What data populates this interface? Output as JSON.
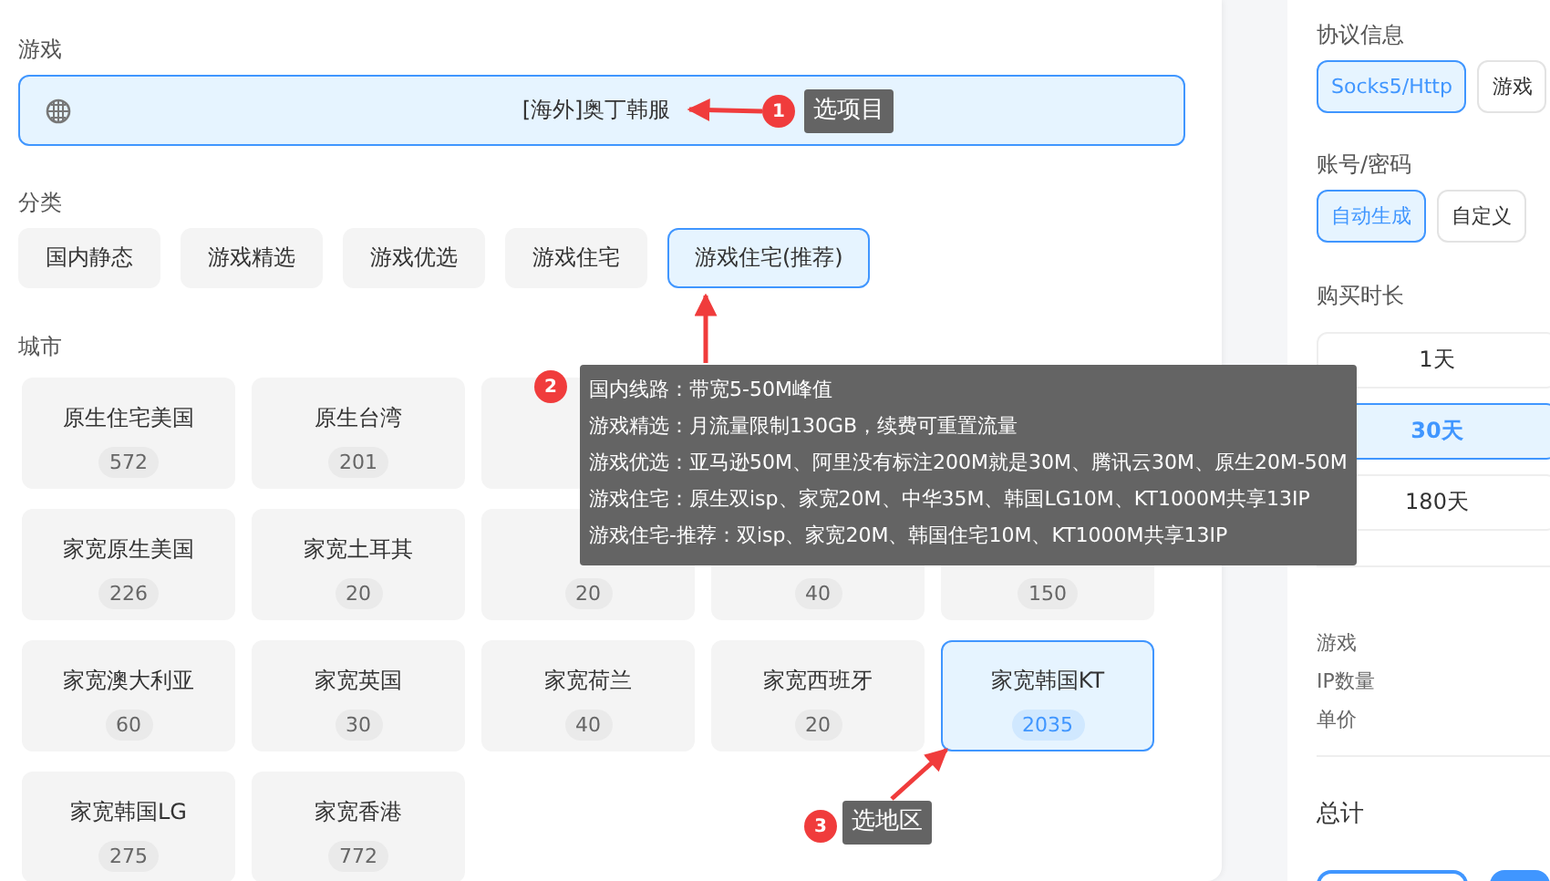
{
  "game": {
    "label": "游戏",
    "value": "[海外]奥丁韩服"
  },
  "category": {
    "label": "分类",
    "options": [
      {
        "label": "国内静态",
        "selected": false
      },
      {
        "label": "游戏精选",
        "selected": false
      },
      {
        "label": "游戏优选",
        "selected": false
      },
      {
        "label": "游戏住宅",
        "selected": false
      },
      {
        "label": "游戏住宅(推荐)",
        "selected": true
      }
    ]
  },
  "city": {
    "label": "城市",
    "cards": [
      {
        "name": "原生住宅美国",
        "count": "572",
        "selected": false
      },
      {
        "name": "原生台湾",
        "count": "201",
        "selected": false
      },
      {
        "selected": false
      },
      {
        "name": "家宽原生美国",
        "count": "226",
        "selected": false
      },
      {
        "name": "家宽土耳其",
        "count": "20",
        "selected": false
      },
      {
        "count": "20",
        "selected": false
      },
      {
        "count": "40",
        "selected": false
      },
      {
        "count": "150",
        "selected": false
      },
      {
        "name": "家宽澳大利亚",
        "count": "60",
        "selected": false
      },
      {
        "name": "家宽英国",
        "count": "30",
        "selected": false
      },
      {
        "name": "家宽荷兰",
        "count": "40",
        "selected": false
      },
      {
        "name": "家宽西班牙",
        "count": "20",
        "selected": false
      },
      {
        "name": "家宽韩国KT",
        "count": "2035",
        "selected": true
      },
      {
        "name": "家宽韩国LG",
        "count": "275",
        "selected": false
      },
      {
        "name": "家宽香港",
        "count": "772",
        "selected": false
      }
    ]
  },
  "order": {
    "protocol": {
      "label": "协议信息",
      "options": [
        {
          "label": "Socks5/Http",
          "selected": true
        },
        {
          "label": "游戏",
          "selected": false
        }
      ]
    },
    "account": {
      "label": "账号/密码",
      "options": [
        {
          "label": "自动生成",
          "selected": true
        },
        {
          "label": "自定义",
          "selected": false
        }
      ]
    },
    "duration": {
      "label": "购买时长",
      "options": [
        {
          "label": "1天",
          "selected": false
        },
        {
          "label": "30天",
          "selected": true
        },
        {
          "label": "180天",
          "selected": false
        }
      ]
    },
    "summary": [
      "游戏",
      "IP数量",
      "单价"
    ],
    "total_label": "总计"
  },
  "annotations": [
    {
      "number": "1",
      "lines": [
        "选项目"
      ]
    },
    {
      "number": "2",
      "lines": [
        "国内线路：带宽5-50M峰值",
        "游戏精选：月流量限制130GB，续费可重置流量",
        "游戏优选：亚马逊50M、阿里没有标注200M就是30M、腾讯云30M、原生20M-50M",
        "游戏住宅：原生双isp、家宽20M、中华35M、韩国LG10M、KT1000M共享13IP",
        "游戏住宅-推荐：双isp、家宽20M、韩国住宅10M、KT1000M共享13IP"
      ]
    },
    {
      "number": "3",
      "lines": [
        "选地区"
      ]
    }
  ]
}
